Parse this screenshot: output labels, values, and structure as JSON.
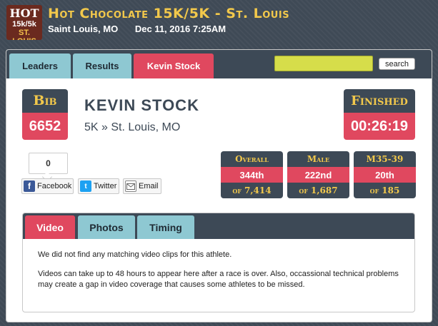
{
  "header": {
    "logo": {
      "top": "HOT",
      "mid": "15k/5k",
      "bottom": "ST. LOUIS"
    },
    "title": "Hot Chocolate 15K/5K - St. Louis",
    "location": "Saint Louis, MO",
    "datetime": "Dec 11, 2016 7:25AM"
  },
  "tabs": [
    {
      "label": "Leaders"
    },
    {
      "label": "Results"
    },
    {
      "label": "Kevin Stock"
    }
  ],
  "search": {
    "value": "",
    "button_label": "search"
  },
  "bib": {
    "label": "Bib",
    "value": "6652"
  },
  "athlete": {
    "name": "KEVIN STOCK",
    "race": "5K » St. Louis, MO"
  },
  "finished": {
    "label": "Finished",
    "time": "00:26:19"
  },
  "social": {
    "like_count": "0",
    "facebook": "Facebook",
    "twitter": "Twitter",
    "email": "Email"
  },
  "rankings": [
    {
      "label": "Overall",
      "place": "344th",
      "of_label": "of",
      "total": "7,414"
    },
    {
      "label": "Male",
      "place": "222nd",
      "of_label": "of",
      "total": "1,687"
    },
    {
      "label": "M35-39",
      "place": "20th",
      "of_label": "of",
      "total": "185"
    }
  ],
  "media": {
    "tabs": [
      {
        "label": "Video"
      },
      {
        "label": "Photos"
      },
      {
        "label": "Timing"
      }
    ],
    "message1": "We did not find any matching video clips for this athlete.",
    "message2": "Videos can take up to 48 hours to appear here after a race is over. Also, occassional technical problems may create a gap in video coverage that causes some athletes to be missed."
  },
  "colors": {
    "accent": "#e0485f",
    "navy": "#3d4956",
    "gold": "#f2c84b",
    "tab": "#8ec8d2",
    "search": "#d6dd4a"
  }
}
